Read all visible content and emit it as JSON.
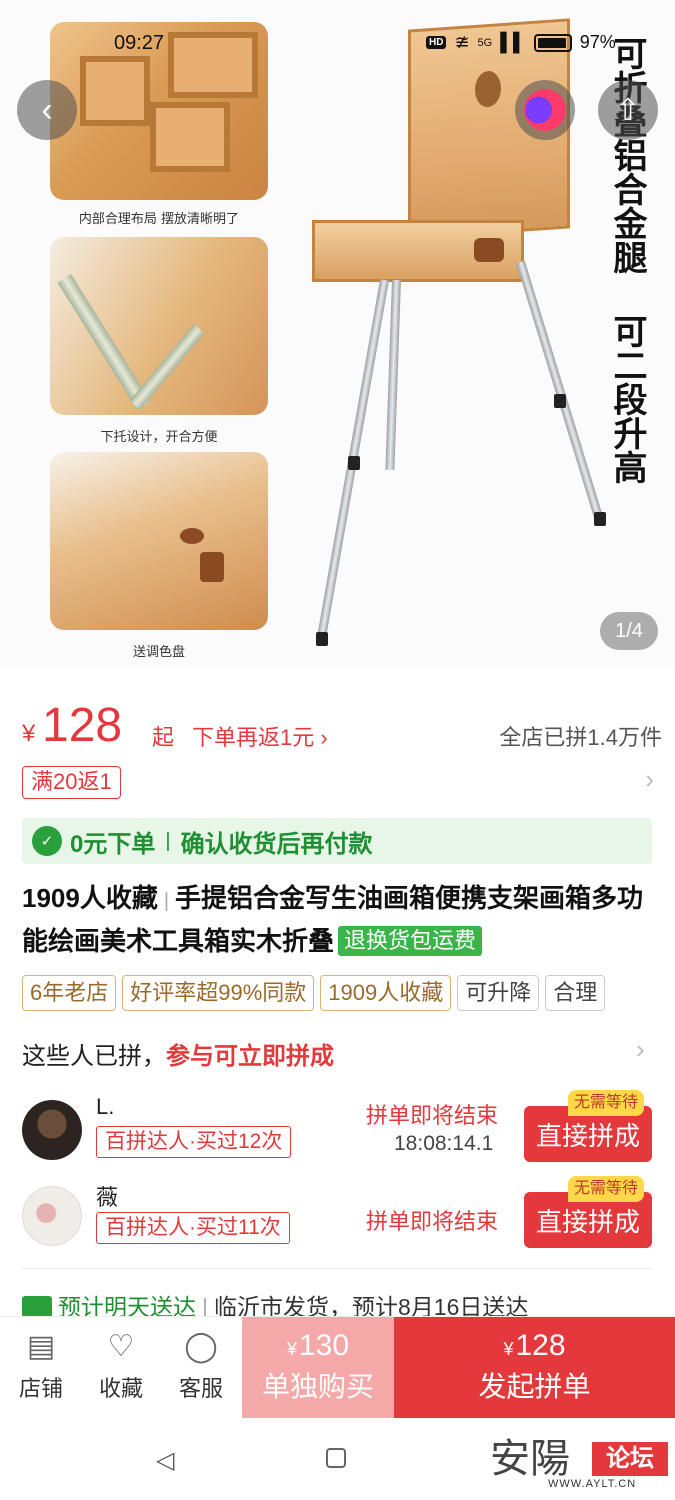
{
  "status_bar": {
    "time": "09:27",
    "network": "HD",
    "signal": "5G",
    "battery": "97%"
  },
  "gallery": {
    "captions": [
      "内部合理布局 摆放清晰明了",
      "下托设计，开合方便",
      "送调色盘"
    ],
    "vertical_text": "可折叠铝合金腿 可二段升高",
    "counter": "1/4"
  },
  "price": {
    "currency": "¥",
    "amount": "128",
    "suffix": "起",
    "rebate": "下单再返1元",
    "sold": "全店已拼1.4万件"
  },
  "coupon": {
    "label": "满20返1"
  },
  "assurance": {
    "left": "0元下单",
    "right": "确认收货后再付款"
  },
  "product": {
    "favorites": "1909人收藏",
    "title": "手提铝合金写生油画箱便携支架画箱多功能绘画美术工具箱实木折叠",
    "return_tag": "退换货包运费"
  },
  "tags": [
    "6年老店",
    "好评率超99%同款",
    "1909人收藏",
    "可升降",
    "合理"
  ],
  "group_buy": {
    "heading": "这些人已拼，",
    "heading_red": "参与可立即拼成",
    "rows": [
      {
        "name": "L.",
        "badge": "百拼达人·买过12次",
        "status": "拼单即将结束",
        "timer": "18:08:14.1",
        "flag": "无需等待",
        "button": "直接拼成"
      },
      {
        "name": "薇",
        "badge": "百拼达人·买过11次",
        "status": "拼单即将结束",
        "timer": "",
        "flag": "无需等待",
        "button": "直接拼成"
      }
    ]
  },
  "shipping": {
    "eta": "预计明天送达",
    "detail": "临沂市发货，预计8月16日送达"
  },
  "bottom_bar": {
    "shop": "店铺",
    "favorite": "收藏",
    "service": "客服",
    "alone_currency": "¥",
    "alone_price": "130",
    "alone_label": "单独购买",
    "group_currency": "¥",
    "group_price": "128",
    "group_label": "发起拼单"
  },
  "watermark": {
    "big": "安陽",
    "red": "论坛",
    "url": "WWW.AYLT.CN"
  },
  "colors": {
    "accent_red": "#e4393c",
    "green": "#2aa03c",
    "pale_red": "#f4a8a8"
  }
}
